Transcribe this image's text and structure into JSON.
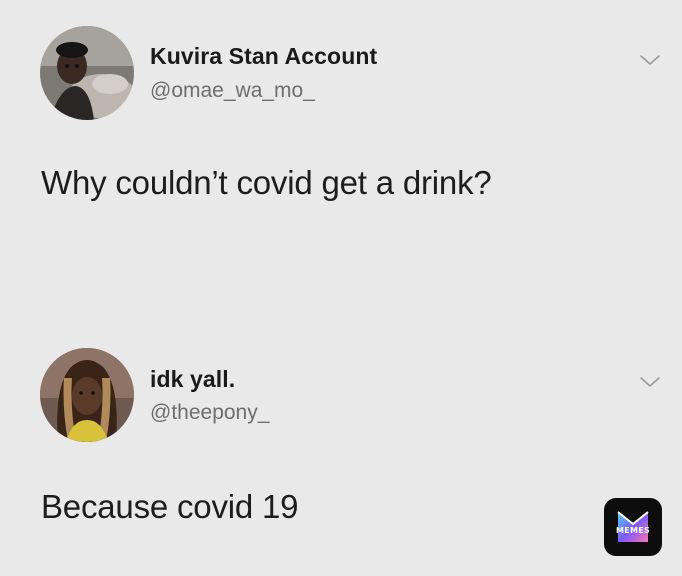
{
  "tweets": [
    {
      "display_name": "Kuvira Stan Account",
      "handle": "@omae_wa_mo_",
      "text": "Why couldn’t covid get a drink?",
      "avatar_icon": "profile-photo",
      "menu_icon": "chevron-down-icon"
    },
    {
      "display_name": "idk yall.",
      "handle": "@theepony_",
      "text": "Because covid 19",
      "avatar_icon": "profile-photo",
      "menu_icon": "chevron-down-icon"
    }
  ],
  "watermark": {
    "label": "MEMES",
    "colors": [
      "#7a5cff",
      "#ff6fb5",
      "#4fd3ff"
    ]
  },
  "colors": {
    "background": "#e9e9e9",
    "text_primary": "#1a1a1a",
    "text_secondary": "#6e6e6e"
  }
}
